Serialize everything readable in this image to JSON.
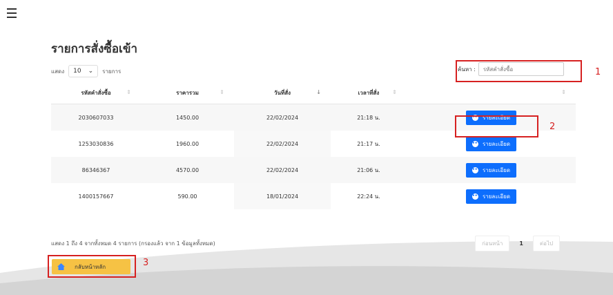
{
  "header": {
    "page_title": "รายการสั่งซื้อเข้า"
  },
  "controls": {
    "show_prefix": "แสดง",
    "page_length": "10",
    "show_suffix": "รายการ",
    "search_label": "ค้นหา :",
    "search_placeholder": "รหัสคำสั่งซื้อ"
  },
  "table": {
    "columns": [
      "รหัสคำสั่งซื้อ",
      "ราคารวม",
      "วันที่สั่ง",
      "เวลาที่สั่ง",
      ""
    ],
    "rows": [
      {
        "order_id": "2030607033",
        "total": "1450.00",
        "date": "22/02/2024",
        "time": "21:18 น.",
        "action": "รายละเอียด"
      },
      {
        "order_id": "1253030836",
        "total": "1960.00",
        "date": "22/02/2024",
        "time": "21:17 น.",
        "action": "รายละเอียด"
      },
      {
        "order_id": "86346367",
        "total": "4570.00",
        "date": "22/02/2024",
        "time": "21:06 น.",
        "action": "รายละเอียด"
      },
      {
        "order_id": "1400157667",
        "total": "590.00",
        "date": "18/01/2024",
        "time": "22:24 น.",
        "action": "รายละเอียด"
      }
    ]
  },
  "footer": {
    "info": "แสดง 1 ถึง 4 จากทั้งหมด 4 รายการ (กรองแล้ว จาก 1 ข้อมูลทั้งหมด)",
    "prev": "ก่อนหน้า",
    "page": "1",
    "next": "ต่อไป",
    "back_home": "กลับหน้าหลัก"
  },
  "annotations": {
    "one": "1",
    "two": "2",
    "three": "3"
  },
  "colors": {
    "primary": "#0d6efd",
    "warning": "#f6c244",
    "annotation": "#d62020"
  }
}
